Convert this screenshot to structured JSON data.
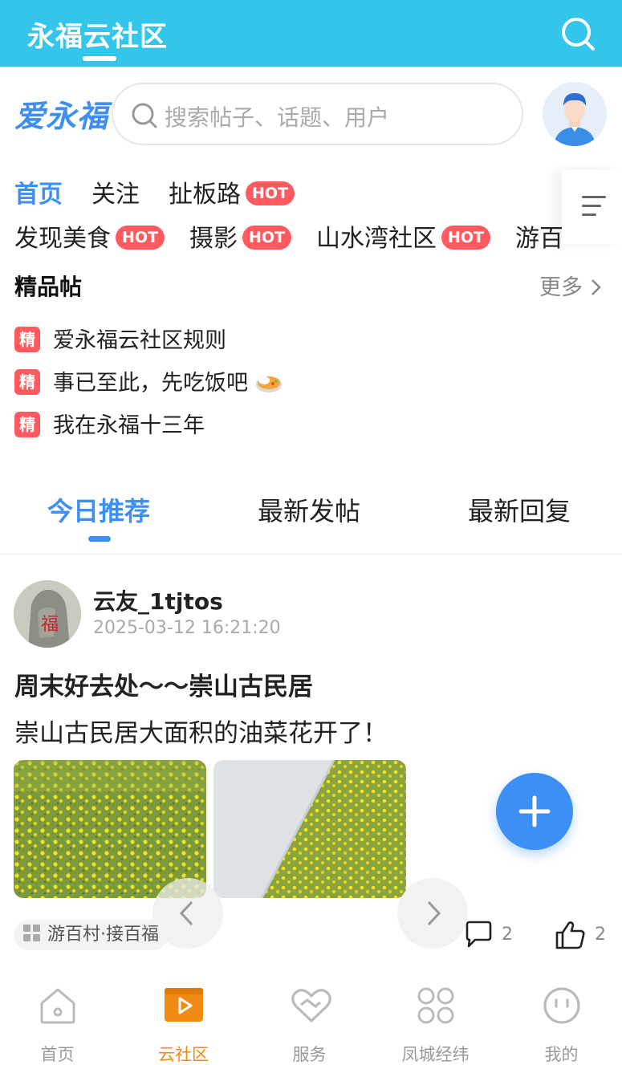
{
  "header": {
    "title": "永福云社区"
  },
  "brand": {
    "name": "爱永福"
  },
  "search": {
    "placeholder": "搜索帖子、话题、用户"
  },
  "categories": {
    "row1": [
      {
        "label": "首页",
        "active": true
      },
      {
        "label": "关注"
      },
      {
        "label": "扯板路",
        "hot": "HOT"
      }
    ],
    "row2": [
      {
        "label": "发现美食",
        "hot": "HOT"
      },
      {
        "label": "摄影",
        "hot": "HOT"
      },
      {
        "label": "山水湾社区",
        "hot": "HOT"
      },
      {
        "label": "游百"
      }
    ]
  },
  "featured": {
    "title": "精品帖",
    "more": "更多",
    "badge": "精",
    "items": [
      {
        "text": "爱永福云社区规则"
      },
      {
        "text": "事已至此，先吃饭吧"
      },
      {
        "text": "我在永福十三年"
      }
    ]
  },
  "feed_tabs": [
    {
      "label": "今日推荐",
      "active": true
    },
    {
      "label": "最新发帖"
    },
    {
      "label": "最新回复"
    }
  ],
  "post": {
    "user": "云友_1tjtos",
    "time": "2025-03-12 16:21:20",
    "title": "周末好去处～～崇山古民居",
    "body": "崇山古民居大面积的油菜花开了！",
    "tag": "游百村·接百福",
    "comments": "2",
    "likes": "2"
  },
  "tabbar": [
    {
      "label": "首页",
      "icon": "home-icon"
    },
    {
      "label": "云社区",
      "icon": "play-icon",
      "active": true
    },
    {
      "label": "服务",
      "icon": "heart-hand-icon"
    },
    {
      "label": "凤城经纬",
      "icon": "grid-icon"
    },
    {
      "label": "我的",
      "icon": "face-icon"
    }
  ],
  "colors": {
    "header_bg": "#33c5ea",
    "accent": "#3d8ef5",
    "hot": "#ff5a5f",
    "tab_active": "#f08a12"
  }
}
